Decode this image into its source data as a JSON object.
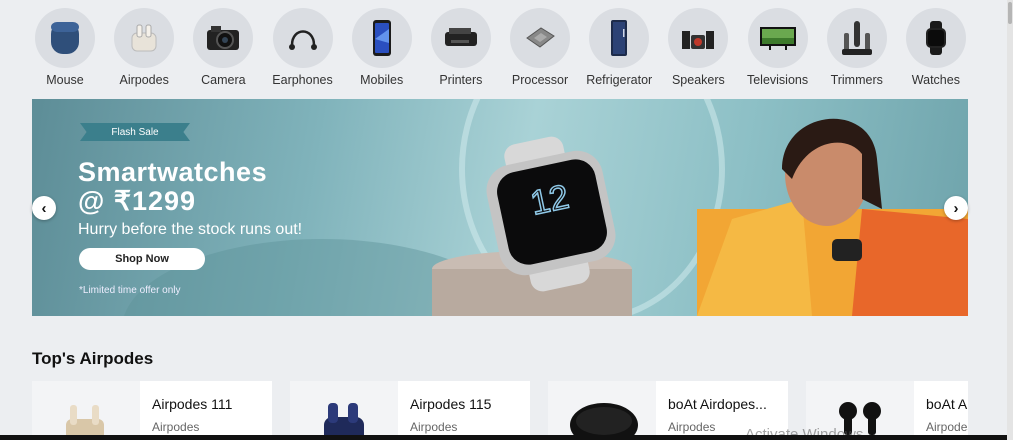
{
  "categories": [
    {
      "label": "Mouse",
      "icon": "mouse-icon"
    },
    {
      "label": "Airpodes",
      "icon": "airpods-icon"
    },
    {
      "label": "Camera",
      "icon": "camera-icon"
    },
    {
      "label": "Earphones",
      "icon": "earphones-icon"
    },
    {
      "label": "Mobiles",
      "icon": "mobile-icon"
    },
    {
      "label": "Printers",
      "icon": "printer-icon"
    },
    {
      "label": "Processor",
      "icon": "processor-icon"
    },
    {
      "label": "Refrigerator",
      "icon": "refrigerator-icon"
    },
    {
      "label": "Speakers",
      "icon": "speakers-icon"
    },
    {
      "label": "Televisions",
      "icon": "television-icon"
    },
    {
      "label": "Trimmers",
      "icon": "trimmer-icon"
    },
    {
      "label": "Watches",
      "icon": "watch-icon"
    }
  ],
  "banner": {
    "tag": "Flash Sale",
    "title": "Smartwatches",
    "price": "@ ₹1299",
    "subtitle": "Hurry before the stock runs out!",
    "cta": "Shop Now",
    "note": "*Limited time offer only",
    "watch_time": "12",
    "prev_arrow": "‹",
    "next_arrow": "›"
  },
  "section": {
    "title": "Top's Airpodes",
    "products": [
      {
        "name": "Airpodes 111",
        "category": "Airpodes"
      },
      {
        "name": "Airpodes 115",
        "category": "Airpodes"
      },
      {
        "name": "boAt Airdopes...",
        "category": "Airpodes"
      },
      {
        "name": "boAt A",
        "category": "Airpodes"
      }
    ]
  },
  "watermark": "Activate Windows",
  "colors": {
    "page_bg": "#eceef1",
    "circle_bg": "#dadde2",
    "banner_teal": "#80b3bb",
    "flash_tag": "#3b7f8c"
  }
}
